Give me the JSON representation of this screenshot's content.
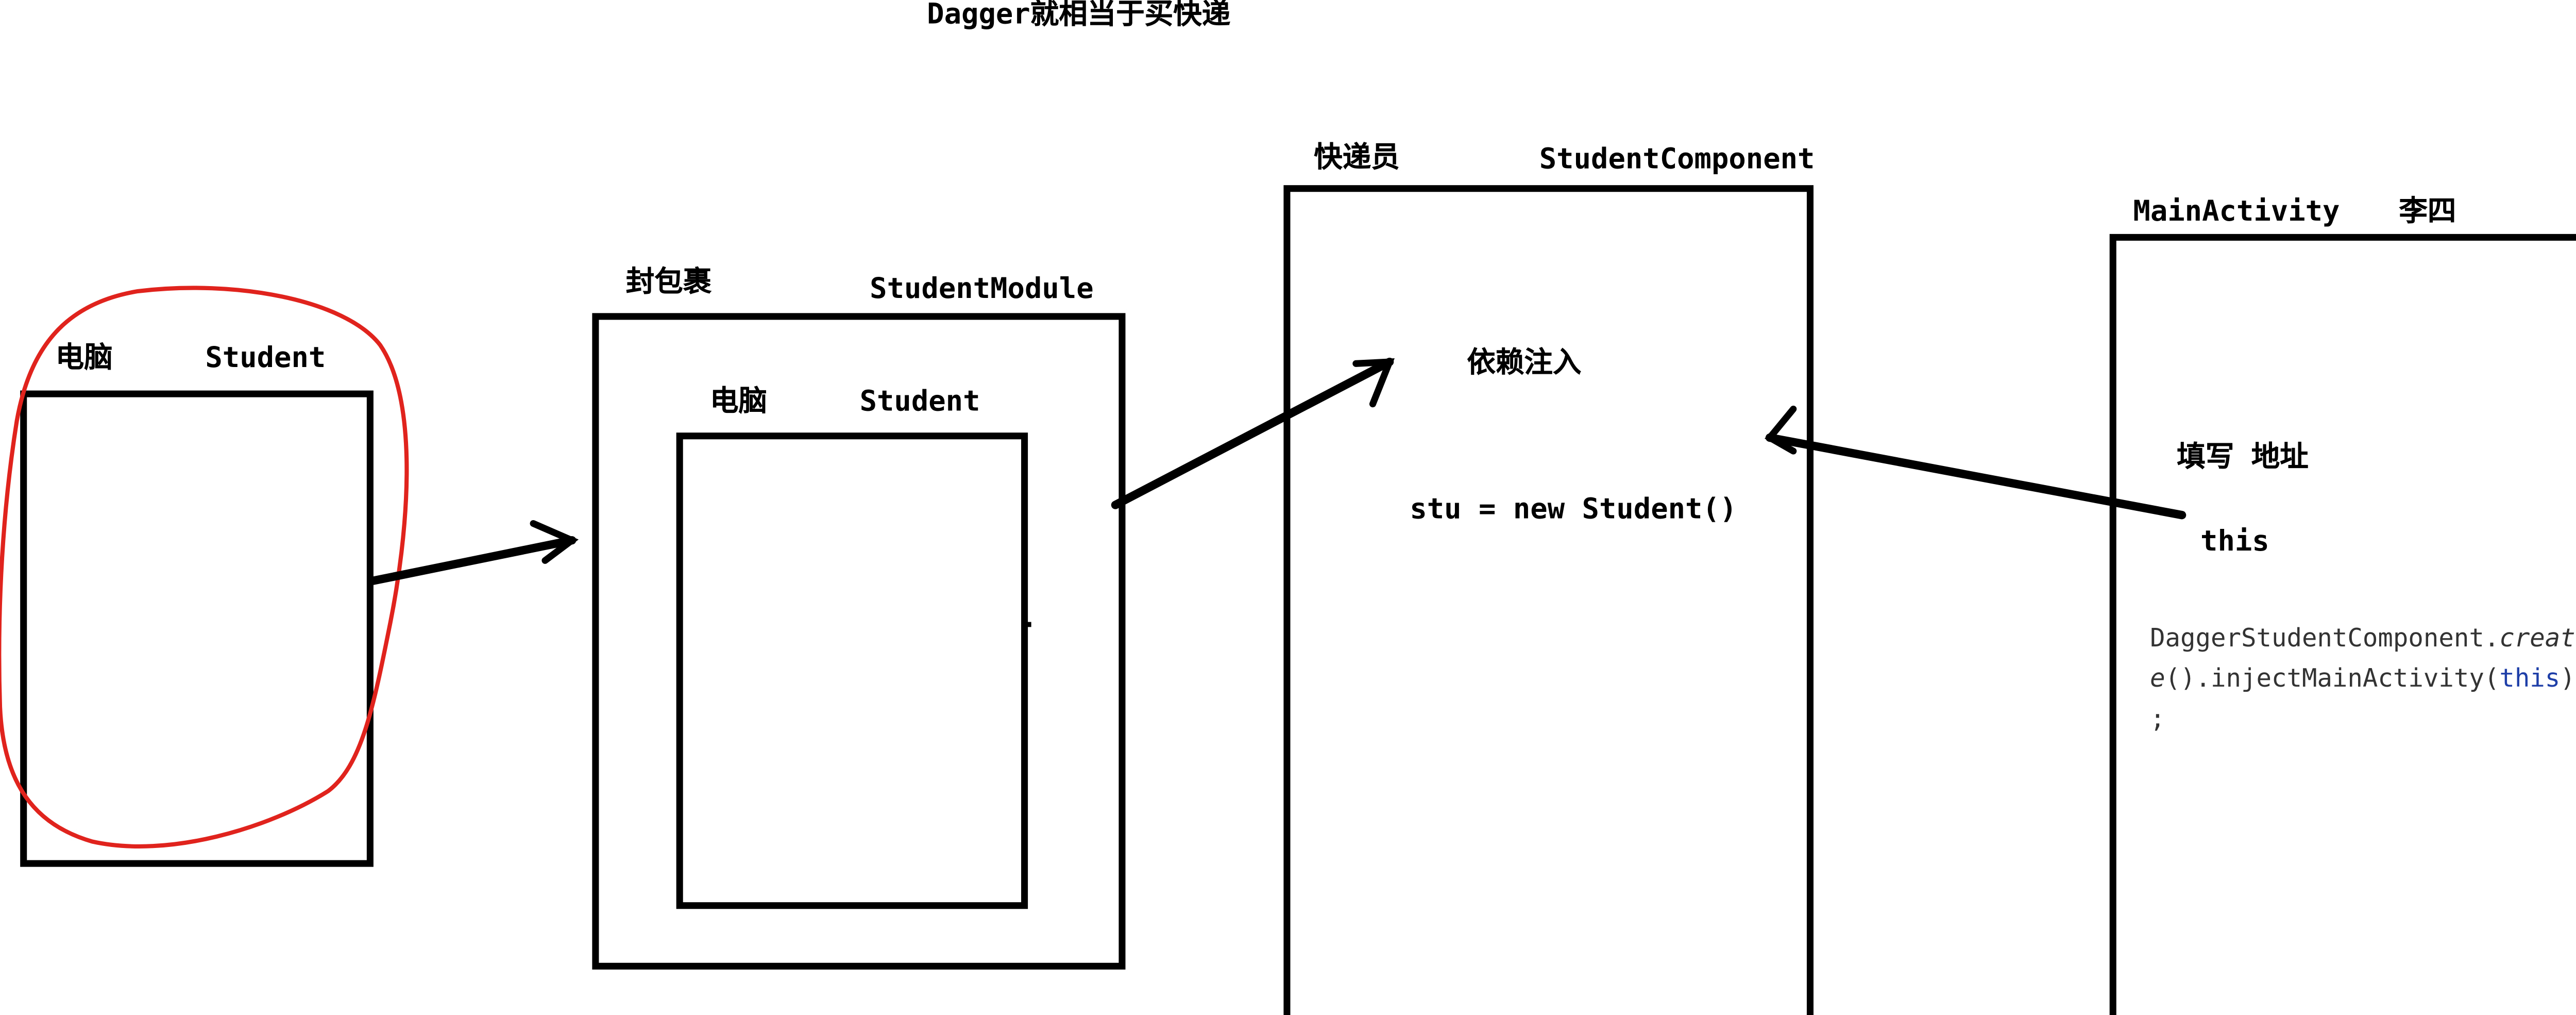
{
  "title": "Dagger就相当于买快递",
  "boxes": {
    "computer": {
      "label_cn": "电脑",
      "label_en": "Student"
    },
    "package": {
      "label_cn": "封包裹",
      "label_en": "StudentModule",
      "inner_label_cn": "电脑",
      "inner_label_en": "Student"
    },
    "courier": {
      "label_cn": "快递员",
      "label_en": "StudentComponent",
      "inject_label": "依赖注入",
      "code_line": "stu = new Student()"
    },
    "activity": {
      "label_en": "MainActivity",
      "label_cn": "李四",
      "fill_label": "填写 地址",
      "this_label": "this",
      "code_part1": "DaggerStudentComponent.",
      "code_part2": "creat",
      "code_part3": "e",
      "code_part4": "().injectMainActivity(",
      "code_part5": "this",
      "code_part6": ")",
      "code_part7": ";"
    }
  },
  "colors": {
    "stroke": "#000000",
    "circle": "#e0231c",
    "this_keyword": "#1f3fa8"
  }
}
